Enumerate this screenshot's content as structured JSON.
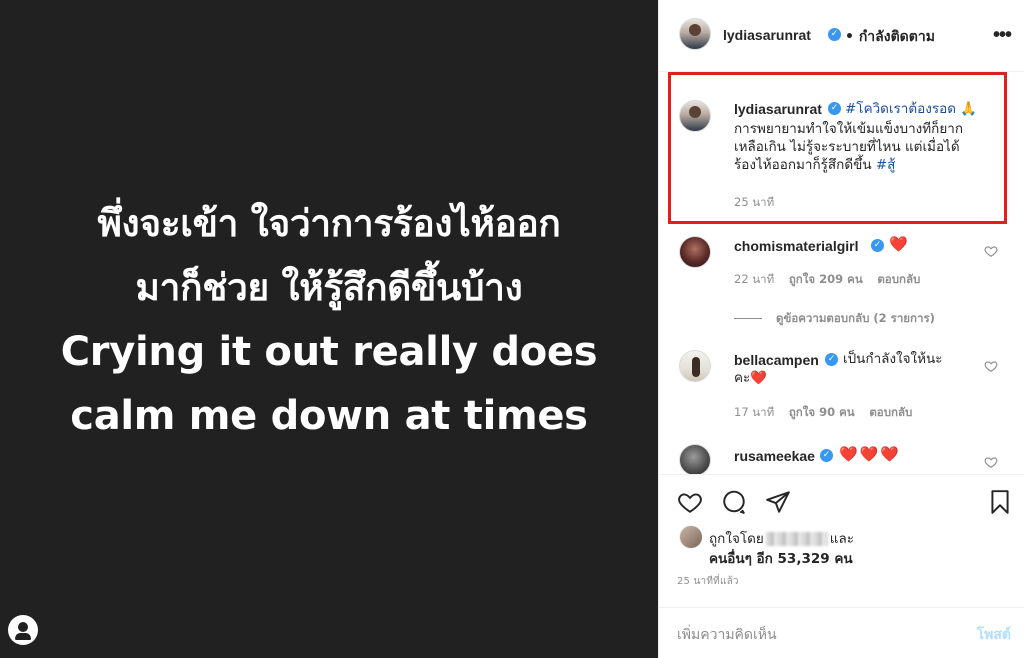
{
  "post": {
    "image_lines": [
      "พึ่งจะเข้า ใจว่าการร้องไห้ออก",
      "มาก็ช่วย ให้รู้สึกดีขึ้นบ้าง",
      "Crying it out really does",
      "calm me down at times"
    ]
  },
  "header": {
    "username": "lydiasarunrat",
    "verified_icon": "verified-badge-icon",
    "follow_status": "• กำลังติดตาม",
    "more_icon": "more-options-icon"
  },
  "caption": {
    "username": "lydiasarunrat",
    "hashtag": "#โควิดเราต้องรอด",
    "emoji": "🙏",
    "line1": "การพยายามทำใจให้เข้มแข็งบางทีก็ยาก",
    "line2": "เหลือเกิน ไม่รู้จะระบายที่ไหน แต่เมื่อได้",
    "line3": "ร้องไห้ออกมาก็รู้สึกดีขึ้น",
    "hashtag2": "#สู้",
    "time": "25 นาที"
  },
  "comments": [
    {
      "username": "chomismaterialgirl",
      "text": "❤️",
      "time": "22 นาที",
      "likes": "ถูกใจ 209 คน",
      "reply": "ตอบกลับ",
      "view_replies": "ดูข้อความตอบกลับ (2 รายการ)"
    },
    {
      "username": "bellacampen",
      "text": "เป็นกำลังใจให้นะ",
      "text2": "คะ❤️",
      "time": "17 นาที",
      "likes": "ถูกใจ 90 คน",
      "reply": "ตอบกลับ"
    },
    {
      "username": "rusameekae",
      "text": "❤️❤️❤️"
    }
  ],
  "actions": {
    "like_icon": "heart-icon",
    "comment_icon": "comment-icon",
    "share_icon": "share-icon",
    "save_icon": "bookmark-icon",
    "liked_by_prefix": "ถูกใจโดย",
    "liked_by_suffix": "และ",
    "others_label": "คนอื่นๆ อีก 53,329 คน",
    "time_ago": "25 นาทีที่แล้ว"
  },
  "add_comment": {
    "placeholder": "เพิ่มความคิดเห็น",
    "post_label": "โพสต์"
  },
  "colors": {
    "image_bg": "#212121",
    "accent_blue": "#3897f0",
    "highlight_red": "#e0201c",
    "heart_red": "#ed1c24"
  }
}
